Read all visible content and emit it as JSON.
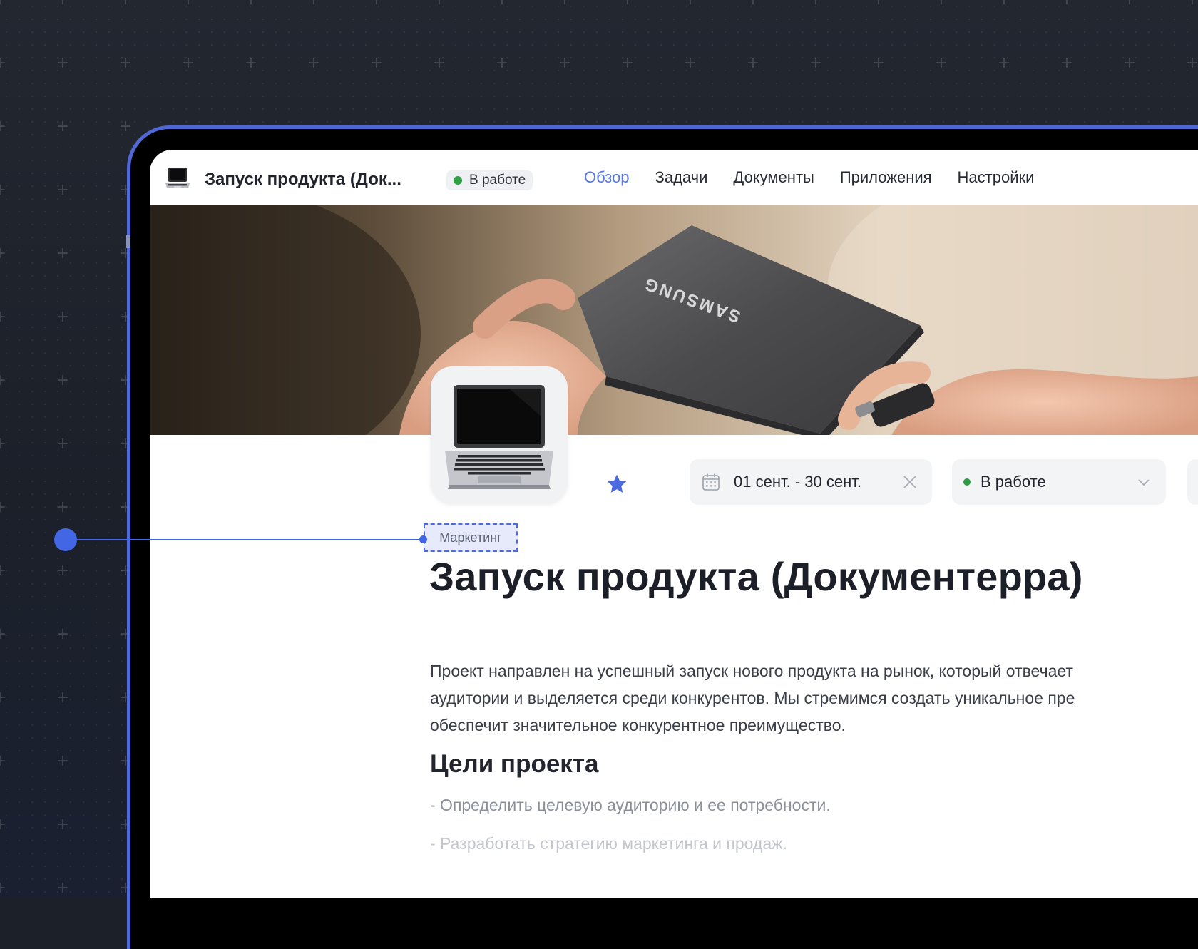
{
  "app": {
    "title": "Запуск продукта (Док...",
    "status_chip": "В работе"
  },
  "tabs": [
    {
      "label": "Обзор",
      "active": true
    },
    {
      "label": "Задачи",
      "active": false
    },
    {
      "label": "Документы",
      "active": false
    },
    {
      "label": "Приложения",
      "active": false
    },
    {
      "label": "Настройки",
      "active": false
    }
  ],
  "banner": {
    "brand_text": "SAMSUNG"
  },
  "toolbar": {
    "date_range": "01 сент. - 30 сент.",
    "status": "В работе"
  },
  "tag": "Маркетинг",
  "page": {
    "title": "Запуск продукта (Документерра)",
    "description_lines": [
      "Проект направлен на успешный запуск нового продукта на рынок, который отвечает",
      "аудитории и выделяется среди конкурентов. Мы стремимся создать уникальное пре",
      "обеспечит значительное конкурентное преимущество."
    ],
    "goals_heading": "Цели проекта",
    "goals": [
      "- Определить целевую аудиторию и ее потребности.",
      "- Разработать стратегию маркетинга и продаж."
    ]
  },
  "colors": {
    "accent": "#5a78e0",
    "frame": "#4f68d6",
    "status_green": "#2ea043",
    "annotation": "#4266e4"
  },
  "icons": {
    "app": "laptop-icon",
    "thumbnail": "laptop-icon",
    "favorite": "star-icon",
    "calendar": "calendar-icon",
    "clear": "close-icon",
    "dropdown": "chevron-down-icon"
  }
}
